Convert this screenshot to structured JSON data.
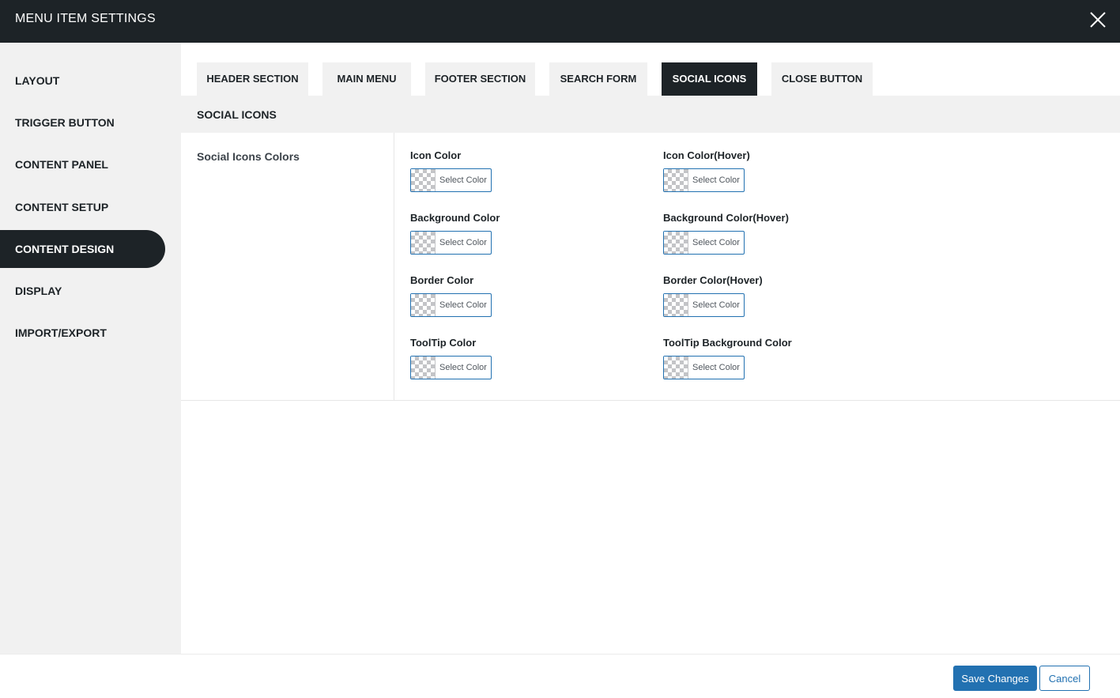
{
  "header": {
    "title": "MENU ITEM SETTINGS",
    "close_icon": "close-icon"
  },
  "sidebar": {
    "items": [
      {
        "label": "LAYOUT",
        "active": false
      },
      {
        "label": "TRIGGER BUTTON",
        "active": false
      },
      {
        "label": "CONTENT PANEL",
        "active": false
      },
      {
        "label": "CONTENT SETUP",
        "active": false
      },
      {
        "label": "CONTENT DESIGN",
        "active": true
      },
      {
        "label": "DISPLAY",
        "active": false
      },
      {
        "label": "IMPORT/EXPORT",
        "active": false
      }
    ]
  },
  "tabs": [
    {
      "label": "HEADER SECTION",
      "active": false
    },
    {
      "label": "MAIN MENU",
      "active": false
    },
    {
      "label": "FOOTER SECTION",
      "active": false
    },
    {
      "label": "SEARCH FORM",
      "active": false
    },
    {
      "label": "SOCIAL ICONS",
      "active": true
    },
    {
      "label": "CLOSE BUTTON",
      "active": false
    }
  ],
  "section": {
    "title": "SOCIAL ICONS",
    "group_label": "Social Icons Colors",
    "fields": [
      {
        "label": "Icon Color",
        "button": "Select Color"
      },
      {
        "label": "Icon Color(Hover)",
        "button": "Select Color"
      },
      {
        "label": "Background Color",
        "button": "Select Color"
      },
      {
        "label": "Background Color(Hover)",
        "button": "Select Color"
      },
      {
        "label": "Border Color",
        "button": "Select Color"
      },
      {
        "label": "Border Color(Hover)",
        "button": "Select Color"
      },
      {
        "label": "ToolTip Color",
        "button": "Select Color"
      },
      {
        "label": "ToolTip Background Color",
        "button": "Select Color"
      }
    ]
  },
  "footer": {
    "save_label": "Save Changes",
    "cancel_label": "Cancel"
  },
  "colors": {
    "dark": "#1d2327",
    "accent": "#2271b1",
    "panel_bg": "#f1f1f1"
  }
}
